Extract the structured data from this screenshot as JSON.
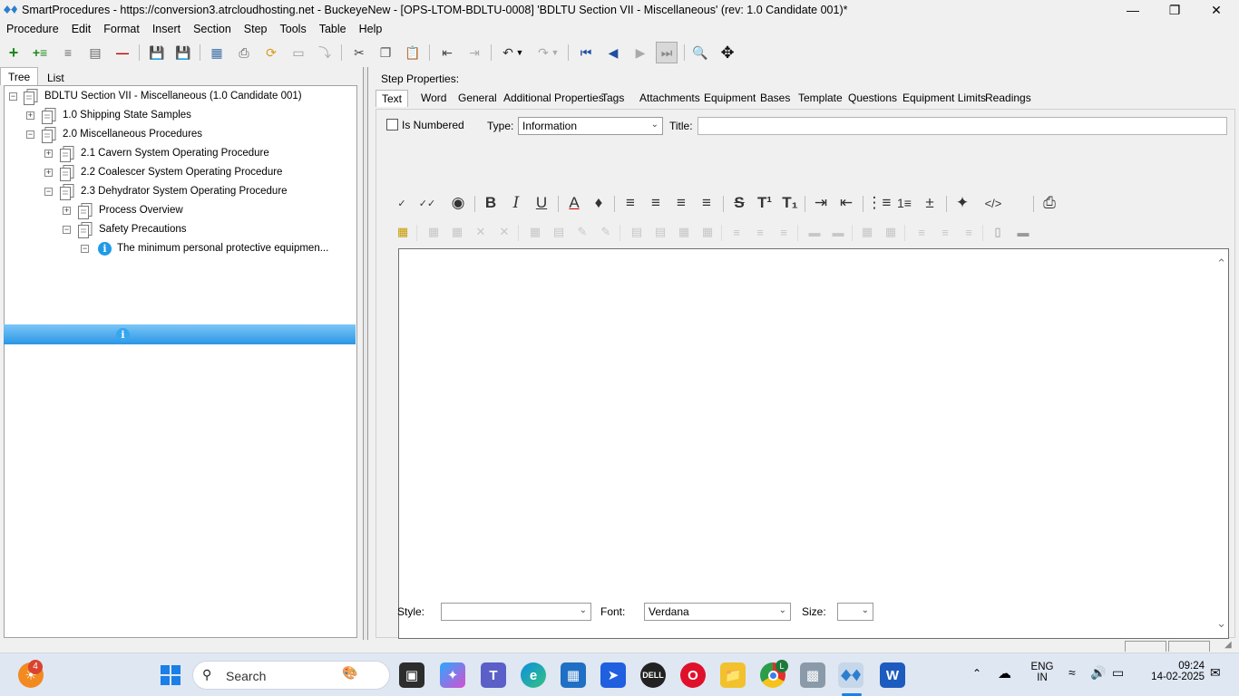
{
  "window": {
    "title": "SmartProcedures - https://conversion3.atrcloudhosting.net - BuckeyeNew - [OPS-LTOM-BDLTU-0008] 'BDLTU Section VII - Miscellaneous' (rev: 1.0 Candidate 001)*"
  },
  "menu": [
    "Procedure",
    "Edit",
    "Format",
    "Insert",
    "Section",
    "Step",
    "Tools",
    "Table",
    "Help"
  ],
  "left_tabs": [
    "Tree",
    "List"
  ],
  "tree": [
    {
      "label": "BDLTU Section VII - Miscellaneous (1.0 Candidate 001)"
    },
    {
      "label": "1.0 Shipping State Samples"
    },
    {
      "label": "2.0 Miscellaneous Procedures"
    },
    {
      "label": "2.1 Cavern System Operating Procedure"
    },
    {
      "label": "2.2 Coalescer System Operating Procedure"
    },
    {
      "label": "2.3 Dehydrator System Operating Procedure"
    },
    {
      "label": "Process Overview"
    },
    {
      "label": "Safety Precautions"
    },
    {
      "label": "The minimum personal protective equipmen..."
    }
  ],
  "right": {
    "header": "Step Properties:",
    "tabs": [
      "Text",
      "Word",
      "General",
      "Additional Properties",
      "Tags",
      "Attachments",
      "Equipment",
      "Bases",
      "Template",
      "Questions",
      "Equipment Limits",
      "Readings"
    ],
    "is_numbered_label": "Is Numbered",
    "type_label": "Type:",
    "type_value": "Information",
    "title_label": "Title:",
    "title_value": "",
    "style_label": "Style:",
    "style_value": "",
    "font_label": "Font:",
    "font_value": "Verdana",
    "size_label": "Size:",
    "size_value": ""
  },
  "taskbar": {
    "search_placeholder": "Search",
    "notification_badge": "4",
    "lang_line1": "ENG",
    "lang_line2": "IN",
    "time": "09:24",
    "date": "14-02-2025",
    "chrome_badge": "L"
  }
}
